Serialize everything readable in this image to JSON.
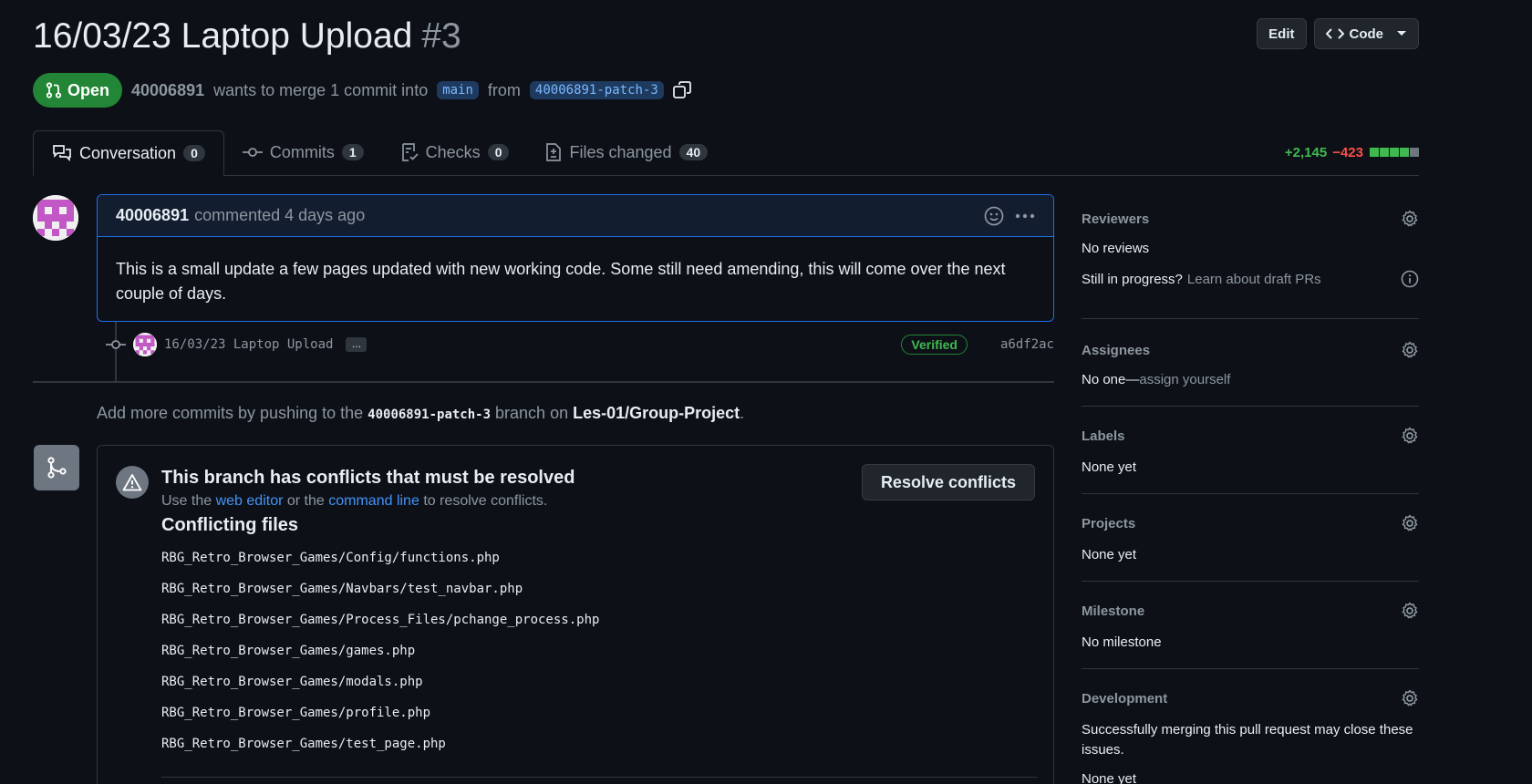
{
  "pr": {
    "title": "16/03/23 Laptop Upload",
    "number": "#3",
    "state": "Open",
    "author": "40006891",
    "merge_text_1": "wants to merge 1 commit into",
    "base_branch": "main",
    "merge_text_2": "from",
    "head_branch": "40006891-patch-3"
  },
  "header_actions": {
    "edit": "Edit",
    "code": "Code"
  },
  "tabs": [
    {
      "label": "Conversation",
      "count": "0",
      "icon": "comment-discussion-icon"
    },
    {
      "label": "Commits",
      "count": "1",
      "icon": "git-commit-icon"
    },
    {
      "label": "Checks",
      "count": "0",
      "icon": "checklist-icon"
    },
    {
      "label": "Files changed",
      "count": "40",
      "icon": "file-diff-icon"
    }
  ],
  "diffstat": {
    "additions": "+2,145",
    "deletions": "−423",
    "colors": [
      "#3fb950",
      "#3fb950",
      "#3fb950",
      "#3fb950",
      "#6e7681"
    ]
  },
  "comment": {
    "author": "40006891",
    "meta": "commented 4 days ago",
    "body": "This is a small update a few pages updated with new working code. Some still need amending, this will come over the next couple of days."
  },
  "commit": {
    "message": "16/03/23 Laptop Upload",
    "ellipsis": "…",
    "badge": "Verified",
    "sha": "a6df2ac"
  },
  "push_hint": {
    "before": "Add more commits by pushing to the",
    "branch": "40006891-patch-3",
    "middle": "branch on",
    "repo": "Les-01/Group-Project",
    "after": "."
  },
  "merge": {
    "title": "This branch has conflicts that must be resolved",
    "sub_1": "Use the",
    "link_1": "web editor",
    "sub_2": "or the",
    "link_2": "command line",
    "sub_3": "to resolve conflicts.",
    "button": "Resolve conflicts",
    "files_title": "Conflicting files",
    "files": [
      "RBG_Retro_Browser_Games/Config/functions.php",
      "RBG_Retro_Browser_Games/Navbars/test_navbar.php",
      "RBG_Retro_Browser_Games/Process_Files/pchange_process.php",
      "RBG_Retro_Browser_Games/games.php",
      "RBG_Retro_Browser_Games/modals.php",
      "RBG_Retro_Browser_Games/profile.php",
      "RBG_Retro_Browser_Games/test_page.php"
    ]
  },
  "sidebar": {
    "reviewers": {
      "title": "Reviewers",
      "value": "No reviews",
      "draft_q": "Still in progress?",
      "draft_link": "Learn about draft PRs"
    },
    "assignees": {
      "title": "Assignees",
      "value": "No one—",
      "link": "assign yourself"
    },
    "labels": {
      "title": "Labels",
      "value": "None yet"
    },
    "projects": {
      "title": "Projects",
      "value": "None yet"
    },
    "milestone": {
      "title": "Milestone",
      "value": "No milestone"
    },
    "development": {
      "title": "Development",
      "value": "Successfully merging this pull request may close these issues.",
      "value2": "None yet"
    }
  }
}
